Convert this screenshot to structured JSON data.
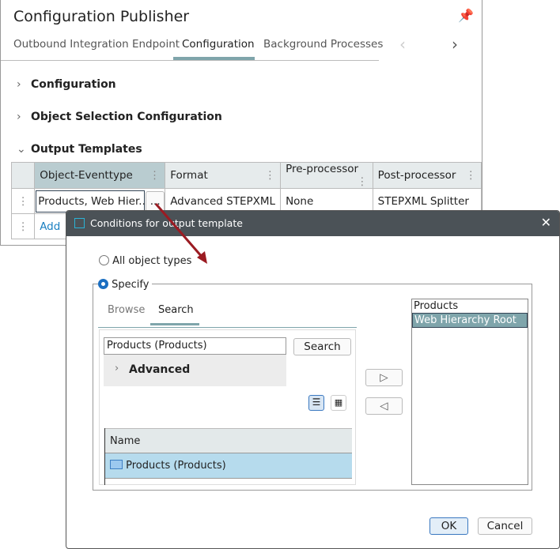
{
  "panel": {
    "title": "Configuration Publisher",
    "tabs": [
      "Outbound Integration Endpoint",
      "Configuration",
      "Background Processes"
    ],
    "sections": [
      "Configuration",
      "Object Selection Configuration",
      "Output Templates"
    ],
    "table": {
      "headers": [
        "Object-Eventtype",
        "Format",
        "Pre-processor",
        "Post-processor"
      ],
      "row": [
        "Products, Web Hier...",
        "Advanced STEPXML",
        "None",
        "STEPXML Splitter"
      ],
      "ellipsis": "...",
      "add_label": "Add"
    }
  },
  "dialog": {
    "title": "Conditions for output template",
    "radio_all": "All object types",
    "radio_specify": "Specify",
    "tabs": [
      "Browse",
      "Search"
    ],
    "search_value": "Products (Products)",
    "search_button": "Search",
    "advanced": "Advanced",
    "results_header": "Name",
    "results": [
      "Products (Products)"
    ],
    "selected": [
      "Products",
      "Web Hierarchy Root"
    ],
    "ok": "OK",
    "cancel": "Cancel"
  }
}
